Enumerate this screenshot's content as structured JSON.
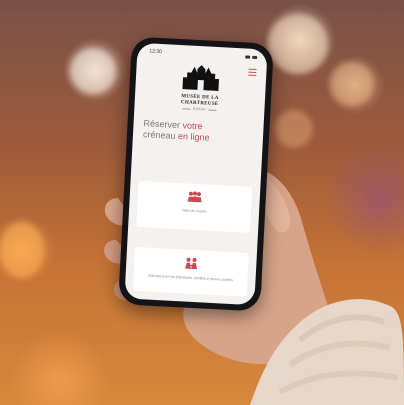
{
  "museum": {
    "name_line1": "MUSÉE DE LA",
    "name_line2": "CHARTREUSE",
    "tagline": "DOUAI"
  },
  "status_bar": {
    "time": "12:30"
  },
  "headline": {
    "part1": "Réserver ",
    "accent1": "votre",
    "part2": "créneau ",
    "accent2": "en ligne"
  },
  "cards": [
    {
      "icon": "group-visit-icon",
      "label": "Visite du musée"
    },
    {
      "icon": "workshop-icon",
      "label": "Activités pour les individuels, familles et jeunes publics"
    }
  ],
  "colors": {
    "accent": "#c94a52",
    "screen_bg": "#f4f1ef",
    "phone_frame": "#141416"
  }
}
